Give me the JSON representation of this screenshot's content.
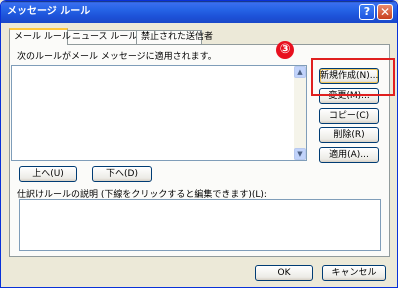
{
  "window": {
    "title": "メッセージ ルール",
    "help_glyph": "?",
    "close_glyph": "✕"
  },
  "tabs": [
    {
      "label": "メール ルール",
      "active": true
    },
    {
      "label": "ニュース ルール",
      "active": false
    },
    {
      "label": "禁止された送信者",
      "active": false
    }
  ],
  "rules": {
    "caption": "次のルールがメール メッセージに適用されます。",
    "list_items": [],
    "scroll_up": "▲",
    "scroll_down": "▼"
  },
  "buttons": {
    "new": "新規作成(N)...",
    "change": "変更(M)...",
    "copy": "コピー(C)",
    "delete": "削除(R)",
    "apply": "適用(A)...",
    "move_up": "上へ(U)",
    "move_down": "下へ(D)",
    "ok": "OK",
    "cancel": "キャンセル"
  },
  "description": {
    "caption": "仕訳けルールの説明 (下線をクリックすると編集できます)(L):",
    "text": ""
  },
  "annotation": {
    "step_number": "③",
    "color": "#e02020"
  },
  "colors": {
    "titlebar": "#2563e6",
    "dialog_bg": "#ece9d8",
    "tab_accent": "#ffc83c"
  }
}
